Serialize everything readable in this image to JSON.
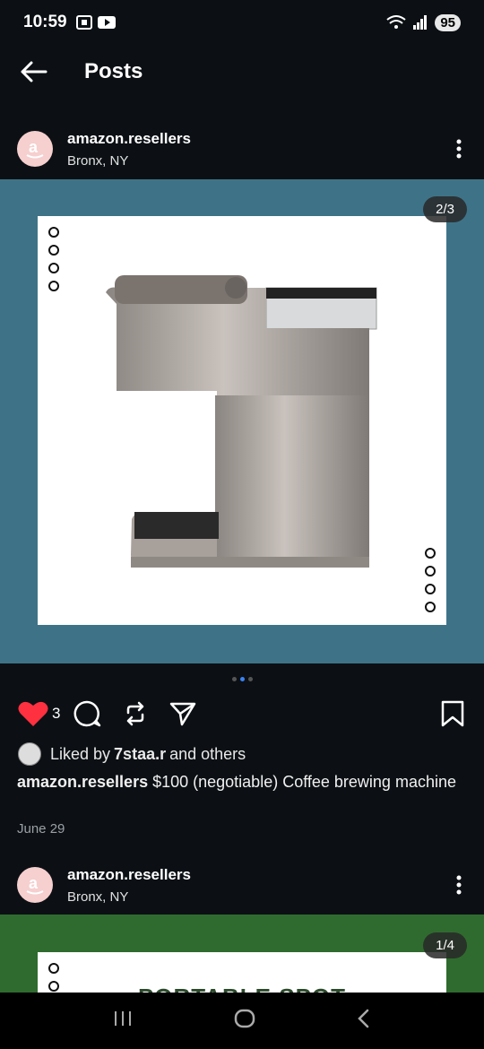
{
  "status": {
    "time": "10:59",
    "battery": "95"
  },
  "header": {
    "title": "Posts"
  },
  "post1": {
    "username": "amazon.resellers",
    "location": "Bronx, NY",
    "counter": "2/3",
    "likes": "3",
    "liked_by_prefix": "Liked by ",
    "liked_by_user": "7staa.r",
    "liked_by_suffix": " and others",
    "caption_user": "amazon.resellers",
    "caption_text": " $100 (negotiable) Coffee brewing machine",
    "date": "June 29"
  },
  "post2": {
    "username": "amazon.resellers",
    "location": "Bronx, NY",
    "counter": "1/4",
    "image_text": "PORTABLE SPOT"
  },
  "colors": {
    "like": "#ff3040",
    "accent": "#3b82f6",
    "image_bg": "#3e7387"
  }
}
